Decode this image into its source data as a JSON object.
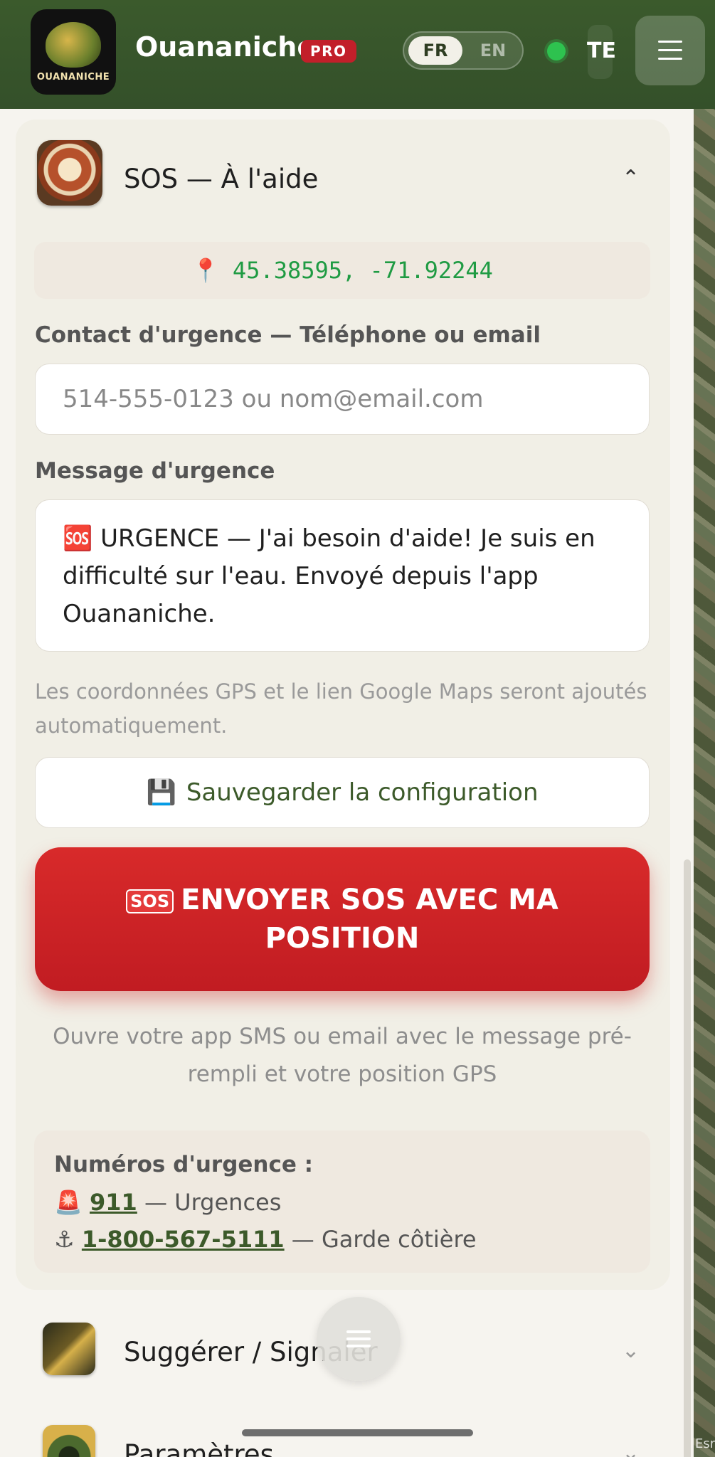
{
  "header": {
    "app_title": "Ouananiche",
    "logo_text": "OUANANICHE",
    "pro_badge": "PRO",
    "lang_fr": "FR",
    "lang_en": "EN",
    "status_label": "TE",
    "status_color": "#2ec24f",
    "brand_color": "#3b5a2c"
  },
  "sos": {
    "title": "SOS — À l'aide",
    "coordinates": "45.38595, -71.92244",
    "contact_label": "Contact d'urgence — Téléphone ou email",
    "contact_placeholder": "514-555-0123 ou nom@email.com",
    "message_label": "Message d'urgence",
    "message_value": "🆘 URGENCE — J'ai besoin d'aide! Je suis en difficulté sur l'eau. Envoyé depuis l'app Ouananiche.",
    "hint": "Les coordonnées GPS et le lien Google Maps seront ajoutés automatiquement.",
    "save_emoji": "💾",
    "save_label": "Sauvegarder la configuration",
    "send_glyph": "SOS",
    "send_label": "ENVOYER SOS AVEC MA POSITION",
    "send_color": "#d82a2a",
    "send_subtext": "Ouvre votre app SMS ou email avec le message pré-rempli et votre position GPS",
    "emergency_title": "Numéros d'urgence :",
    "emergency_numbers": [
      {
        "emoji": "🚨",
        "number": "911",
        "desc": " — Urgences"
      },
      {
        "emoji": "⚓",
        "number": "1-800-567-5111",
        "desc": " — Garde côtière"
      }
    ]
  },
  "sections": {
    "suggest_title": "Suggérer / Signaler",
    "settings_title": "Paramètres"
  },
  "map_credit": "Esri"
}
